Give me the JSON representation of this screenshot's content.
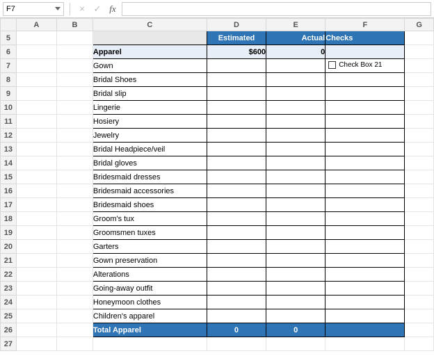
{
  "formula_bar": {
    "namebox": "F7",
    "cancel": "×",
    "enter": "✓",
    "fx": "fx",
    "formula": ""
  },
  "columns": [
    "A",
    "B",
    "C",
    "D",
    "E",
    "F",
    "G"
  ],
  "row_numbers": [
    "5",
    "6",
    "7",
    "8",
    "9",
    "10",
    "11",
    "12",
    "13",
    "14",
    "15",
    "16",
    "17",
    "18",
    "19",
    "20",
    "21",
    "22",
    "23",
    "24",
    "25",
    "26",
    "27"
  ],
  "header": {
    "c_blank": "",
    "estimated": "Estimated",
    "actual": "Actual",
    "checks": "Checks"
  },
  "section": {
    "title": "Apparel",
    "estimated": "$600",
    "actual": "0"
  },
  "items": [
    "Gown",
    "Bridal Shoes",
    "Bridal slip",
    "Lingerie",
    "Hosiery",
    "Jewelry",
    "Bridal Headpiece/veil",
    "Bridal gloves",
    "Bridesmaid dresses",
    "Bridesmaid accessories",
    "Bridesmaid shoes",
    "Groom's tux",
    "Groomsmen tuxes",
    "Garters",
    "Gown preservation",
    "Alterations",
    "Going-away outfit",
    "Honeymoon clothes",
    "Children's apparel"
  ],
  "checkbox_label": "Check Box 21",
  "total": {
    "label": "Total Apparel",
    "estimated": "0",
    "actual": "0"
  }
}
